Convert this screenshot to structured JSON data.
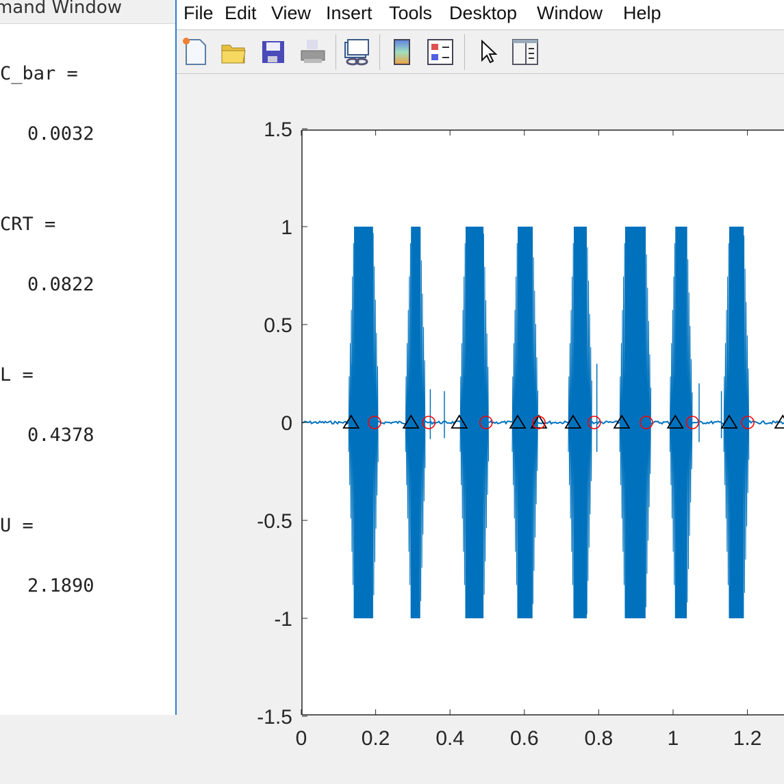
{
  "command_window": {
    "title": "Command Window",
    "lines": [
      {
        "name": "C_bar",
        "label": "C_bar =",
        "value": "0.0032"
      },
      {
        "name": "CRT",
        "label": "CRT =",
        "value": "0.0822"
      },
      {
        "name": "L",
        "label": "L =",
        "value": "0.4378"
      },
      {
        "name": "U",
        "label": "U =",
        "value": "2.1890"
      }
    ]
  },
  "figure": {
    "menu": [
      "File",
      "Edit",
      "View",
      "Insert",
      "Tools",
      "Desktop",
      "Window",
      "Help"
    ],
    "toolbar": [
      "new-figure-icon",
      "open-file-icon",
      "save-icon",
      "print-icon",
      "link-plot-icon",
      "colorbar-icon",
      "legend-icon",
      "pointer-icon",
      "property-editor-icon"
    ]
  },
  "chart_data": {
    "type": "line",
    "xlim": [
      0,
      1.3
    ],
    "ylim": [
      -1.5,
      1.5
    ],
    "x_ticks": [
      "0",
      "0.2",
      "0.4",
      "0.6",
      "0.8",
      "1",
      "1.2"
    ],
    "y_ticks": [
      "1.5",
      "1",
      "0.5",
      "0",
      "-0.5",
      "-1",
      "-1.5"
    ],
    "grid": false,
    "colors": {
      "signal": "#0072bd",
      "triangle": "#000000",
      "circle": "#ff0000"
    },
    "signal_bursts": [
      {
        "start": 0.142,
        "end": 0.193,
        "amplitude": 1
      },
      {
        "start": 0.295,
        "end": 0.32,
        "amplitude": 1
      },
      {
        "start": 0.442,
        "end": 0.49,
        "amplitude": 1
      },
      {
        "start": 0.582,
        "end": 0.622,
        "amplitude": 1
      },
      {
        "start": 0.733,
        "end": 0.768,
        "amplitude": 1
      },
      {
        "start": 0.871,
        "end": 0.926,
        "amplitude": 1
      },
      {
        "start": 1.006,
        "end": 1.037,
        "amplitude": 1
      },
      {
        "start": 1.151,
        "end": 1.19,
        "amplitude": 1
      }
    ],
    "triangle_markers_x": [
      0.134,
      0.295,
      0.425,
      0.582,
      0.639,
      0.731,
      0.862,
      1.006,
      1.151,
      1.295
    ],
    "circle_markers_x": [
      0.197,
      0.343,
      0.497,
      0.639,
      0.788,
      0.928,
      1.052,
      1.201
    ],
    "markers_y": 0
  }
}
